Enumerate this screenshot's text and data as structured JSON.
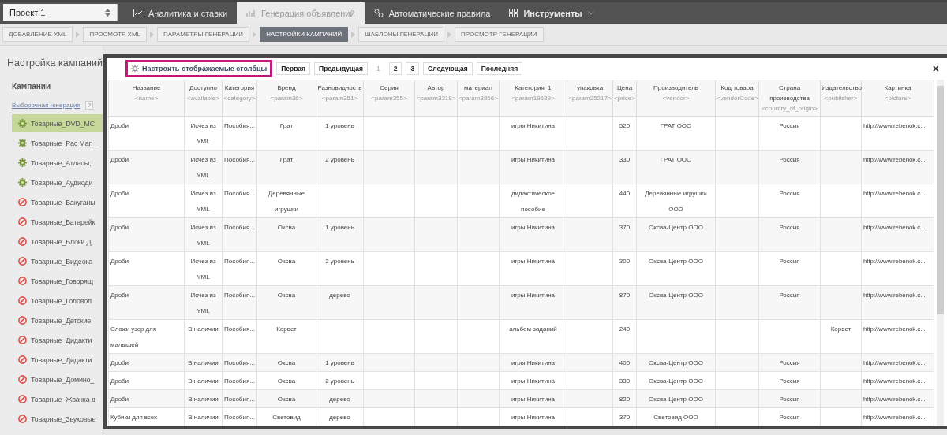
{
  "project_select": {
    "value": "Проект 1"
  },
  "tabs": [
    {
      "label": "Аналитика и ставки",
      "selected": false,
      "dropdown": false
    },
    {
      "label": "Генерация объявлений",
      "selected": true,
      "dropdown": false
    },
    {
      "label": "Автоматические правила",
      "selected": false,
      "dropdown": false
    },
    {
      "label": "Инструменты",
      "selected": false,
      "dropdown": true
    }
  ],
  "steps": [
    {
      "label": "ДОБАВЛЕНИЕ XML",
      "selected": false
    },
    {
      "label": "ПРОСМОТР XML",
      "selected": false
    },
    {
      "label": "ПАРАМЕТРЫ ГЕНЕРАЦИИ",
      "selected": false
    },
    {
      "label": "НАСТРОЙКИ КАМПАНИЙ",
      "selected": true
    },
    {
      "label": "ШАБЛОНЫ ГЕНЕРАЦИИ",
      "selected": false
    },
    {
      "label": "ПРОСМОТР ГЕНЕРАЦИИ",
      "selected": false
    }
  ],
  "sidebar": {
    "title": "Настройка кампаний",
    "section": "Кампании",
    "link": "Выборочная генерация",
    "help": "?",
    "items": [
      {
        "label": "Товарные_DVD_MC",
        "active": true,
        "selected": true
      },
      {
        "label": "Товарные_Pac Man_",
        "active": true,
        "selected": false
      },
      {
        "label": "Товарные_Атласы,",
        "active": true,
        "selected": false
      },
      {
        "label": "Товарные_Аудиоди",
        "active": true,
        "selected": false
      },
      {
        "label": "Товарные_Бакуганы",
        "active": false,
        "selected": false
      },
      {
        "label": "Товарные_Батарейк",
        "active": false,
        "selected": false
      },
      {
        "label": "Товарные_Блоки Д",
        "active": false,
        "selected": false
      },
      {
        "label": "Товарные_Видеока",
        "active": false,
        "selected": false
      },
      {
        "label": "Товарные_Говорящ",
        "active": false,
        "selected": false
      },
      {
        "label": "Товарные_Головол",
        "active": false,
        "selected": false
      },
      {
        "label": "Товарные_Детские",
        "active": false,
        "selected": false
      },
      {
        "label": "Товарные_Дидакти",
        "active": false,
        "selected": false
      },
      {
        "label": "Товарные_Дидакти",
        "active": false,
        "selected": false
      },
      {
        "label": "Товарные_Домино_",
        "active": false,
        "selected": false
      },
      {
        "label": "Товарные_Жвачка д",
        "active": false,
        "selected": false
      },
      {
        "label": "Товарные_Звуковые",
        "active": false,
        "selected": false
      }
    ]
  },
  "dialog": {
    "configure_button": "Настроить отображаемые столбцы",
    "pager": {
      "first": "Первая",
      "prev": "Предыдущая",
      "pages": [
        {
          "label": "1",
          "selected": true
        },
        {
          "label": "2",
          "selected": false
        },
        {
          "label": "3",
          "selected": false
        }
      ],
      "next": "Следующая",
      "last": "Последняя"
    },
    "close": "×",
    "table": {
      "columns": [
        {
          "title": "Название",
          "key": "<name>"
        },
        {
          "title": "Доступно",
          "key": "<available>"
        },
        {
          "title": "Категория",
          "key": "<category>"
        },
        {
          "title": "Бренд",
          "key": "<param36>"
        },
        {
          "title": "Разновидность",
          "key": "<param351>"
        },
        {
          "title": "Серия",
          "key": "<param355>"
        },
        {
          "title": "Автор",
          "key": "<param3318>"
        },
        {
          "title": "материал",
          "key": "<param8866>"
        },
        {
          "title": "Категория_1",
          "key": "<param19639>"
        },
        {
          "title": "упаковка",
          "key": "<param25217>"
        },
        {
          "title": "Цена",
          "key": "<price>"
        },
        {
          "title": "Производитель",
          "key": "<vendor>"
        },
        {
          "title": "Код товара",
          "key": "<vendorCode>"
        },
        {
          "title": "Страна производства",
          "key": "<country_of_origin>"
        },
        {
          "title": "Издательство",
          "key": "<publisher>"
        },
        {
          "title": "Картинка",
          "key": "<picture>"
        }
      ],
      "rows": [
        {
          "cells": [
            "Дроби",
            "Исчез из YML",
            "Пособия...",
            "Грат",
            "1 уровень",
            null,
            null,
            null,
            "игры Никитина",
            null,
            "520",
            "ГРАТ ООО",
            null,
            "Россия",
            null,
            "http://www.rebenok.c..."
          ]
        },
        {
          "cells": [
            "Дроби",
            "Исчез из YML",
            "Пособия...",
            "Грат",
            "2 уровень",
            null,
            null,
            null,
            "игры Никитина",
            null,
            "330",
            "ГРАТ ООО",
            null,
            "Россия",
            null,
            "http://www.rebenok.c..."
          ]
        },
        {
          "cells": [
            "Дроби",
            "Исчез из YML",
            "Пособия...",
            "Деревянные игрушки",
            null,
            null,
            null,
            null,
            "дидактическое пособие",
            null,
            "440",
            "Деревянные игрушки ООО",
            null,
            "Россия",
            null,
            "http://www.rebenok.c..."
          ]
        },
        {
          "cells": [
            "Дроби",
            "Исчез из YML",
            "Пособия...",
            "Оксва",
            "1 уровень",
            null,
            null,
            null,
            "игры Никитина",
            null,
            "370",
            "Оксва-Центр ООО",
            null,
            "Россия",
            null,
            "http://www.rebenok.c..."
          ]
        },
        {
          "cells": [
            "Дроби",
            "Исчез из YML",
            "Пособия...",
            "Оксва",
            "2 уровень",
            null,
            null,
            null,
            "игры Никитина",
            null,
            "300",
            "Оксва-Центр ООО",
            null,
            "Россия",
            null,
            "http://www.rebenok.c..."
          ]
        },
        {
          "cells": [
            "Дроби",
            "Исчез из YML",
            "Пособия...",
            "Оксва",
            "дерево",
            null,
            null,
            null,
            "игры Никитина",
            null,
            "870",
            "Оксва-Центр ООО",
            null,
            "Россия",
            null,
            "http://www.rebenok.c..."
          ]
        },
        {
          "cells": [
            "Сложи узор для малышей",
            "В наличии",
            "Пособия...",
            "Корвет",
            null,
            null,
            null,
            null,
            "альбом заданий",
            null,
            "240",
            null,
            null,
            null,
            "Корвет",
            "http://www.rebenok.c..."
          ]
        },
        {
          "cells": [
            "Дроби",
            "В наличии",
            "Пособия...",
            "Оксва",
            "1 уровень",
            null,
            null,
            null,
            "игры Никитина",
            null,
            "400",
            "Оксва-Центр ООО",
            null,
            "Россия",
            null,
            "http://www.rebenok.c..."
          ]
        },
        {
          "cells": [
            "Дроби",
            "В наличии",
            "Пособия...",
            "Оксва",
            "2 уровень",
            null,
            null,
            null,
            "игры Никитина",
            null,
            "330",
            "Оксва-Центр ООО",
            null,
            "Россия",
            null,
            "http://www.rebenok.c..."
          ]
        },
        {
          "cells": [
            "Дроби",
            "В наличии",
            "Пособия...",
            "Оксва",
            "дерево",
            null,
            null,
            null,
            "игры Никитина",
            null,
            "820",
            "Оксва-Центр ООО",
            null,
            "Россия",
            null,
            "http://www.rebenok.c..."
          ]
        },
        {
          "cells": [
            "Кубики для всех",
            "В наличии",
            "Пособия...",
            "Световид",
            "дерево",
            null,
            null,
            null,
            "игры Никитина",
            null,
            "370",
            "Световид ООО",
            null,
            "Россия",
            null,
            "http://www.rebenok.c..."
          ]
        }
      ]
    }
  }
}
